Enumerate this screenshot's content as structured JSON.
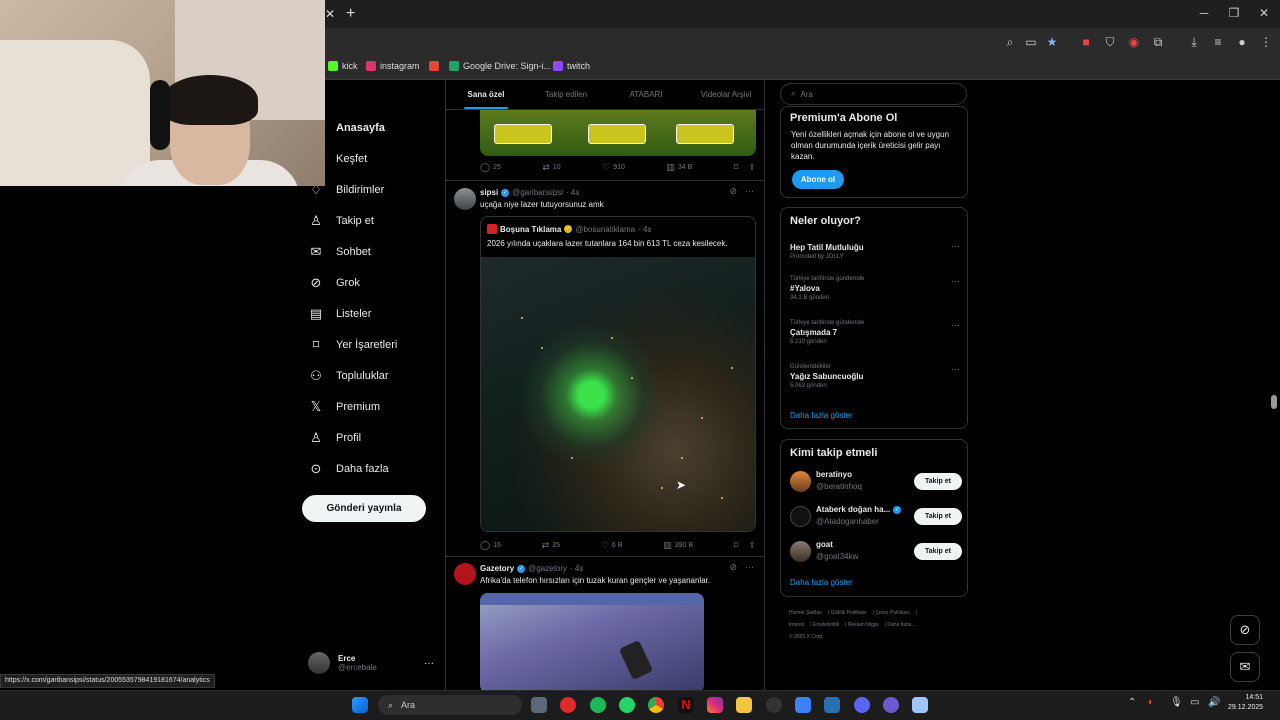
{
  "browser": {
    "toolbar_icons": [
      "zoom-icon",
      "cast-icon",
      "star-icon",
      "extension-icon",
      "shield-icon",
      "adblock-icon",
      "puzzle-icon",
      "download-icon",
      "tabsearch-icon",
      "profile-icon",
      "menu-icon"
    ],
    "bookmarks": [
      {
        "label": "kick",
        "color": "#53fc18"
      },
      {
        "label": "instagram",
        "color": "#e1306c"
      },
      {
        "label": "",
        "color": "#ea4335"
      },
      {
        "label": "Google Drive: Sign-i...",
        "color": "#1fa463"
      },
      {
        "label": "twitch",
        "color": "#9146ff"
      }
    ],
    "status_url": "https://x.com/garibansipsi/status/2005535798419181674/analytics"
  },
  "nav": {
    "items": [
      {
        "label": "Anasayfa",
        "icon": "home-icon"
      },
      {
        "label": "Keşfet",
        "icon": "search-icon"
      },
      {
        "label": "Bildirimler",
        "icon": "bell-icon"
      },
      {
        "label": "Takip et",
        "icon": "follow-icon"
      },
      {
        "label": "Sohbet",
        "icon": "mail-icon"
      },
      {
        "label": "Grok",
        "icon": "grok-icon"
      },
      {
        "label": "Listeler",
        "icon": "list-icon"
      },
      {
        "label": "Yer İşaretleri",
        "icon": "bookmark-icon"
      },
      {
        "label": "Topluluklar",
        "icon": "communities-icon"
      },
      {
        "label": "Premium",
        "icon": "x-icon"
      },
      {
        "label": "Profil",
        "icon": "profile-icon"
      },
      {
        "label": "Daha fazla",
        "icon": "more-icon"
      }
    ],
    "post_button": "Gönderi yayınla",
    "account": {
      "name": "Erce",
      "handle": "@ercebale"
    }
  },
  "feed": {
    "tabs": [
      "Sana özel",
      "Takip edilen",
      "ATABARI",
      "Videolar Arşivi"
    ],
    "top_actions": {
      "replies": "25",
      "reposts": "10",
      "likes": "910",
      "views": "34 B"
    },
    "tweet1": {
      "name": "sipsi",
      "handle": "@garibansipsi",
      "time": "· 4s",
      "text": "uçağa niye lazer tutuyorsunuz amk",
      "quote": {
        "name": "Boşuna Tıklama",
        "handle": "@bosunatiklama",
        "time": "· 4s",
        "text": "2026 yılında uçaklara lazer tutanlara 164 bin 613 TL ceza kesilecek."
      },
      "actions": {
        "replies": "16",
        "reposts": "25",
        "likes": "6 B",
        "views": "390 B"
      }
    },
    "tweet2": {
      "name": "Gazetory",
      "handle": "@gazetory",
      "time": "· 4s",
      "text": "Afrika'da telefon hırsızları için tuzak kuran gençler ve yaşananlar."
    }
  },
  "sidebar": {
    "search_placeholder": "Ara",
    "premium": {
      "title": "Premium'a Abone Ol",
      "desc": "Yeni özellikleri açmak için abone ol ve uygun olman durumunda içerik üreticisi gelir payı kazan.",
      "button": "Abone ol"
    },
    "trends": {
      "title": "Neler oluyor?",
      "items": [
        {
          "context": "",
          "title": "Hep Tatil Mutluluğu",
          "count": "Promoted by JOLLY"
        },
        {
          "context": "Türkiye tarihinde gündemde",
          "title": "#Yalova",
          "count": "34,1 B gönderi"
        },
        {
          "context": "Türkiye tarihinde gündemde",
          "title": "Çatışmada 7",
          "count": "5.210 gönderi"
        },
        {
          "context": "Gündemdekiler",
          "title": "Yağız Sabuncuoğlu",
          "count": "5.063 gönderi"
        }
      ],
      "show_more": "Daha fazla göster"
    },
    "who_to_follow": {
      "title": "Kimi takip etmeli",
      "items": [
        {
          "name": "beratinyo",
          "handle": "@beratinhoq",
          "button": "Takip et"
        },
        {
          "name": "Ataberk doğan ha...",
          "handle": "@Atadoganhaber",
          "button": "Takip et"
        },
        {
          "name": "goat",
          "handle": "@goat34kw",
          "button": "Takip et"
        }
      ],
      "show_more": "Daha fazla göster"
    },
    "footer": [
      "Hizmet Şartları",
      "Gizlilik Politikası",
      "Çerez Politikası",
      "Imprint",
      "Erişilebilirlik",
      "Reklam bilgisi",
      "Daha fazla ...",
      "© 2025 X Corp."
    ]
  },
  "taskbar": {
    "search": "Ara",
    "time": "14:51",
    "date": "29.12.2025"
  }
}
